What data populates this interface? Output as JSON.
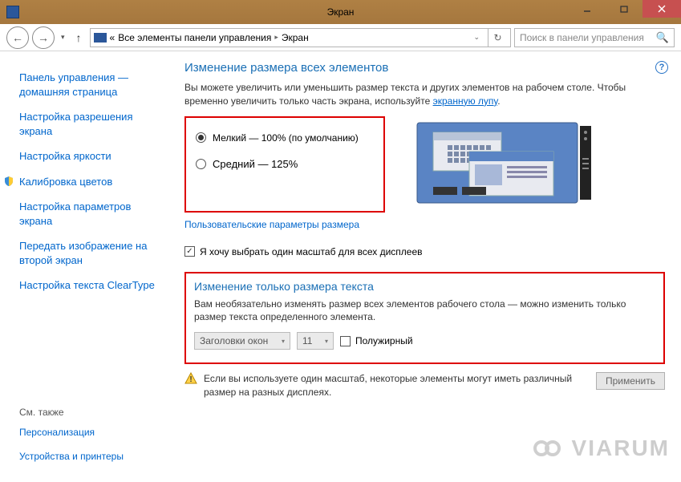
{
  "titlebar": {
    "title": "Экран"
  },
  "navbar": {
    "breadcrumb": {
      "prefix": "«",
      "item1": "Все элементы панели управления",
      "item2": "Экран"
    },
    "search_placeholder": "Поиск в панели управления"
  },
  "sidebar": {
    "links": [
      "Панель управления — домашняя страница",
      "Настройка разрешения экрана",
      "Настройка яркости",
      "Калибровка цветов",
      "Настройка параметров экрана",
      "Передать изображение на второй экран",
      "Настройка текста ClearType"
    ],
    "footer_heading": "См. также",
    "footer_links": [
      "Персонализация",
      "Устройства и принтеры"
    ]
  },
  "main": {
    "heading1": "Изменение размера всех элементов",
    "desc1_a": "Вы можете увеличить или уменьшить размер текста и других элементов на рабочем столе. Чтобы временно увеличить только часть экрана, используйте ",
    "desc1_link": "экранную лупу",
    "desc1_b": ".",
    "radios": {
      "opt1": "Мелкий — 100% (по умолчанию)",
      "opt2": "Средний — 125%"
    },
    "custom_link": "Пользовательские параметры размера",
    "checkbox_label": "Я хочу выбрать один масштаб для всех дисплеев",
    "heading2": "Изменение только размера текста",
    "desc2": "Вам необязательно изменять размер всех элементов рабочего стола — можно изменить только размер текста определенного элемента.",
    "combo_element": "Заголовки окон",
    "combo_size": "11",
    "bold_label": "Полужирный",
    "warning_text": "Если вы используете один масштаб, некоторые элементы могут иметь различный размер на разных дисплеях.",
    "apply_btn": "Применить"
  },
  "watermark": "VIARUM"
}
